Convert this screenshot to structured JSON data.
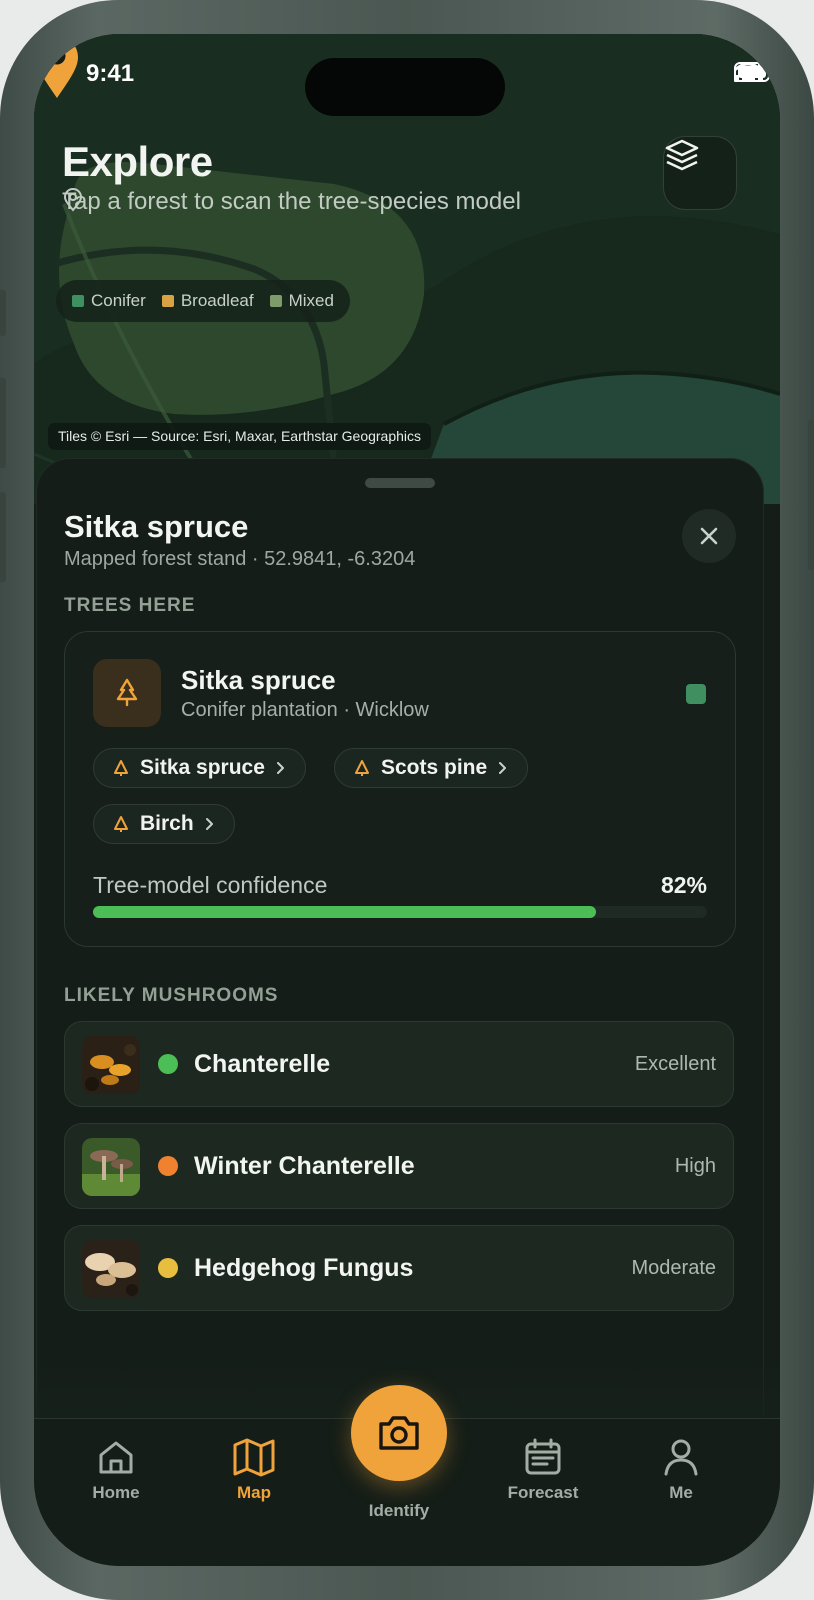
{
  "status_bar": {
    "time": "9:41"
  },
  "header": {
    "title": "Explore",
    "subtitle": "Tap a forest to scan the tree-species model"
  },
  "legend": [
    {
      "label": "Conifer",
      "color": "#3f8f60"
    },
    {
      "label": "Broadleaf",
      "color": "#d9a343"
    },
    {
      "label": "Mixed",
      "color": "#7f9b6a"
    }
  ],
  "map": {
    "attribution": "Tiles © Esri — Source: Esri, Maxar, Earthstar Geographics",
    "pin_color": "#f0a33a"
  },
  "sheet": {
    "title": "Sitka spruce",
    "subtitle": "Mapped forest stand · 52.9841, -6.3204",
    "trees_label": "TREES HERE",
    "tree_card": {
      "name": "Sitka spruce",
      "sub": "Conifer plantation · Wicklow",
      "chips": [
        "Sitka spruce",
        "Scots pine",
        "Birch"
      ],
      "confidence_label": "Tree-model confidence",
      "confidence_text": "82%",
      "confidence_value": 0.82
    },
    "mushrooms_label": "LIKELY MUSHROOMS",
    "mushrooms": [
      {
        "name": "Chanterelle",
        "rating": "Excellent",
        "dot_color": "#4bbf55"
      },
      {
        "name": "Winter Chanterelle",
        "rating": "High",
        "dot_color": "#f0822f"
      },
      {
        "name": "Hedgehog Fungus",
        "rating": "Moderate",
        "dot_color": "#e8be3f"
      }
    ]
  },
  "tabs": {
    "home": "Home",
    "map": "Map",
    "identify": "Identify",
    "forecast": "Forecast",
    "me": "Me"
  },
  "accent_color": "#f0a33a"
}
